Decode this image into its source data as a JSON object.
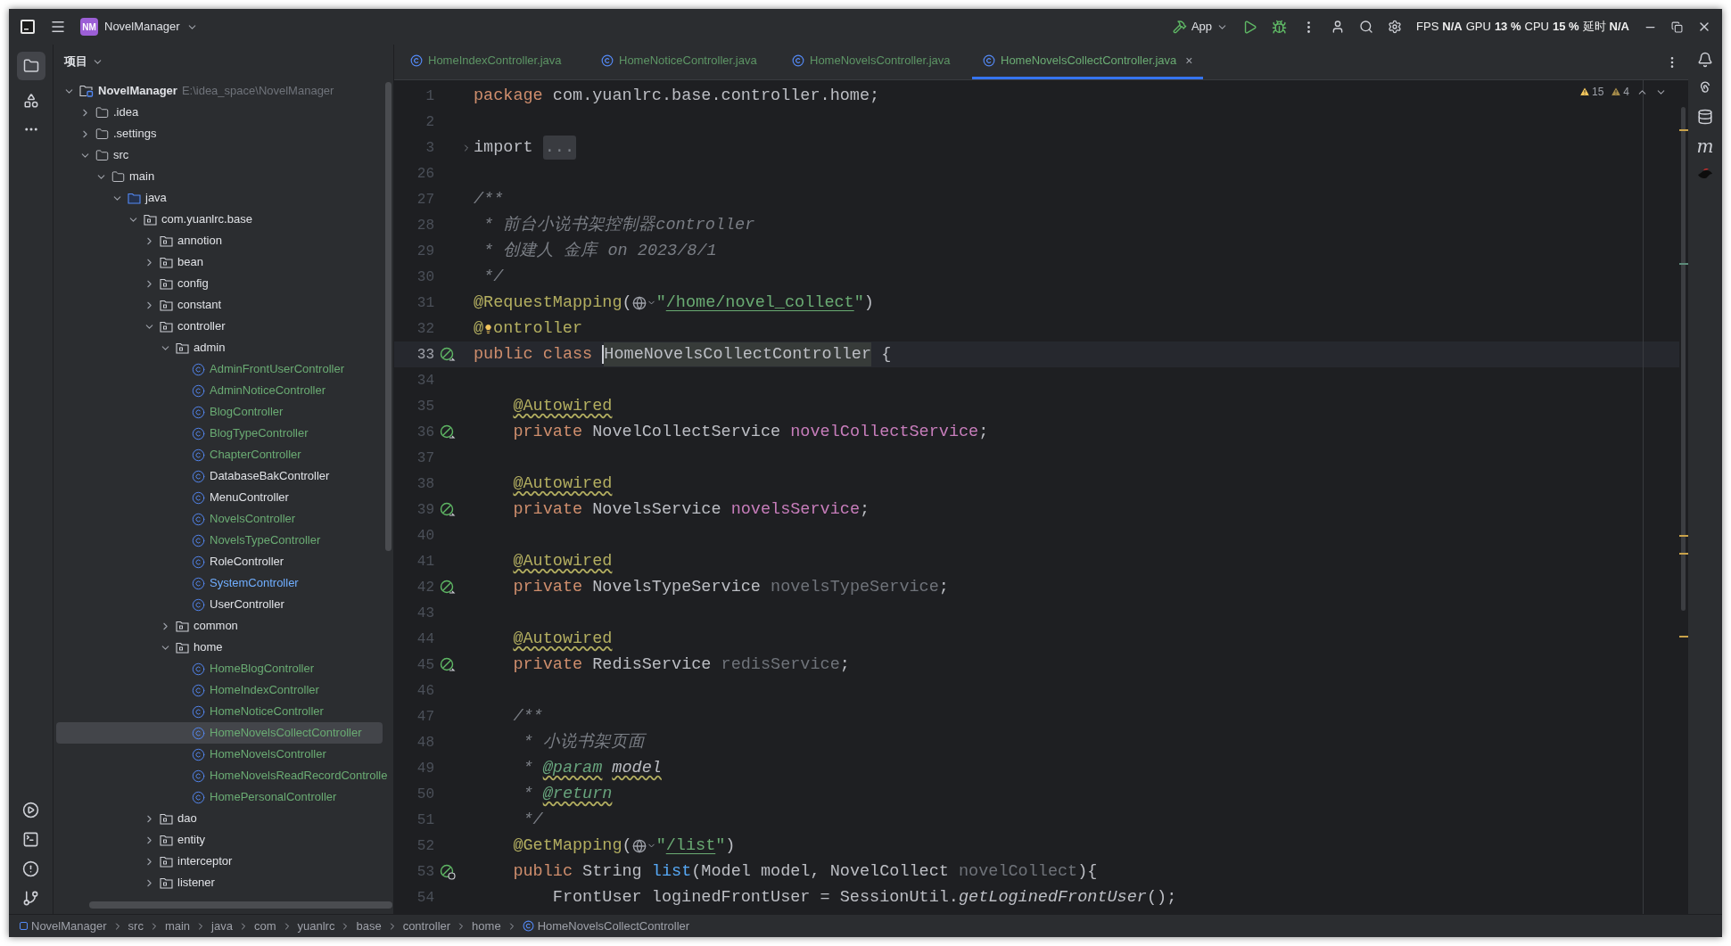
{
  "title_bar": {
    "project_badge": "NM",
    "project_name": "NovelManager",
    "run_config": "App",
    "metrics": [
      {
        "label": "FPS",
        "value": "N/A"
      },
      {
        "label": "GPU",
        "value": "13 %"
      },
      {
        "label": "CPU",
        "value": "15 %"
      },
      {
        "label": "延时",
        "value": "N/A"
      }
    ]
  },
  "project_panel": {
    "title": "项目",
    "tree": [
      {
        "label": "NovelManager",
        "kind": "project",
        "path": "E:\\idea_space\\NovelManager",
        "expanded": true,
        "selected": false,
        "children": [
          {
            "label": ".idea",
            "kind": "folder",
            "expanded": false,
            "selected": false
          },
          {
            "label": ".settings",
            "kind": "folder",
            "expanded": false,
            "selected": false
          },
          {
            "label": "src",
            "kind": "folder",
            "expanded": true,
            "selected": false,
            "children": [
              {
                "label": "main",
                "kind": "folder",
                "expanded": true,
                "selected": false,
                "children": [
                  {
                    "label": "java",
                    "kind": "source-root",
                    "expanded": true,
                    "selected": false,
                    "children": [
                      {
                        "label": "com.yuanlrc.base",
                        "kind": "package",
                        "expanded": true,
                        "selected": false,
                        "children": [
                          {
                            "label": "annotion",
                            "kind": "package",
                            "expanded": false,
                            "selected": false
                          },
                          {
                            "label": "bean",
                            "kind": "package",
                            "expanded": false,
                            "selected": false
                          },
                          {
                            "label": "config",
                            "kind": "package",
                            "expanded": false,
                            "selected": false
                          },
                          {
                            "label": "constant",
                            "kind": "package",
                            "expanded": false,
                            "selected": false
                          },
                          {
                            "label": "controller",
                            "kind": "package",
                            "expanded": true,
                            "selected": false,
                            "children": [
                              {
                                "label": "admin",
                                "kind": "package",
                                "expanded": true,
                                "selected": false,
                                "children": [
                                  {
                                    "label": "AdminFrontUserController",
                                    "kind": "class",
                                    "color": "#6aab73",
                                    "selected": false
                                  },
                                  {
                                    "label": "AdminNoticeController",
                                    "kind": "class",
                                    "color": "#6aab73",
                                    "selected": false
                                  },
                                  {
                                    "label": "BlogController",
                                    "kind": "class",
                                    "color": "#6aab73",
                                    "selected": false
                                  },
                                  {
                                    "label": "BlogTypeController",
                                    "kind": "class",
                                    "color": "#6aab73",
                                    "selected": false
                                  },
                                  {
                                    "label": "ChapterController",
                                    "kind": "class",
                                    "color": "#6aab73",
                                    "selected": false
                                  },
                                  {
                                    "label": "DatabaseBakController",
                                    "kind": "class",
                                    "color": "#dfe1e5",
                                    "selected": false
                                  },
                                  {
                                    "label": "MenuController",
                                    "kind": "class",
                                    "color": "#dfe1e5",
                                    "selected": false
                                  },
                                  {
                                    "label": "NovelsController",
                                    "kind": "class",
                                    "color": "#6aab73",
                                    "selected": false
                                  },
                                  {
                                    "label": "NovelsTypeController",
                                    "kind": "class",
                                    "color": "#6aab73",
                                    "selected": false
                                  },
                                  {
                                    "label": "RoleController",
                                    "kind": "class",
                                    "color": "#dfe1e5",
                                    "selected": false
                                  },
                                  {
                                    "label": "SystemController",
                                    "kind": "class",
                                    "color": "#70aeff",
                                    "selected": false
                                  },
                                  {
                                    "label": "UserController",
                                    "kind": "class",
                                    "color": "#dfe1e5",
                                    "selected": false
                                  }
                                ]
                              },
                              {
                                "label": "common",
                                "kind": "package",
                                "expanded": false,
                                "selected": false
                              },
                              {
                                "label": "home",
                                "kind": "package",
                                "expanded": true,
                                "selected": false,
                                "children": [
                                  {
                                    "label": "HomeBlogController",
                                    "kind": "class",
                                    "color": "#6aab73",
                                    "selected": false
                                  },
                                  {
                                    "label": "HomeIndexController",
                                    "kind": "class",
                                    "color": "#6aab73",
                                    "selected": false
                                  },
                                  {
                                    "label": "HomeNoticeController",
                                    "kind": "class",
                                    "color": "#6aab73",
                                    "selected": false
                                  },
                                  {
                                    "label": "HomeNovelsCollectController",
                                    "kind": "class",
                                    "color": "#6aab73",
                                    "selected": true
                                  },
                                  {
                                    "label": "HomeNovelsController",
                                    "kind": "class",
                                    "color": "#6aab73",
                                    "selected": false
                                  },
                                  {
                                    "label": "HomeNovelsReadRecordControlle",
                                    "kind": "class",
                                    "color": "#6aab73",
                                    "selected": false
                                  },
                                  {
                                    "label": "HomePersonalController",
                                    "kind": "class",
                                    "color": "#6aab73",
                                    "selected": false
                                  }
                                ]
                              }
                            ]
                          },
                          {
                            "label": "dao",
                            "kind": "package",
                            "expanded": false,
                            "selected": false
                          },
                          {
                            "label": "entity",
                            "kind": "package",
                            "expanded": false,
                            "selected": false
                          },
                          {
                            "label": "interceptor",
                            "kind": "package",
                            "expanded": false,
                            "selected": false
                          },
                          {
                            "label": "listener",
                            "kind": "package",
                            "expanded": false,
                            "selected": false
                          }
                        ]
                      }
                    ]
                  }
                ]
              }
            ]
          }
        ]
      }
    ]
  },
  "tabs": [
    {
      "label": "HomeIndexController.java",
      "selected": false
    },
    {
      "label": "HomeNoticeController.java",
      "selected": false
    },
    {
      "label": "HomeNovelsController.java",
      "selected": false
    },
    {
      "label": "HomeNovelsCollectController.java",
      "selected": true,
      "close": "×"
    }
  ],
  "editor": {
    "warnings": "15",
    "weak_warnings": "4",
    "lines": [
      {
        "number": "1",
        "kind": "top",
        "current": false,
        "tokens": [
          {
            "kind": "kw",
            "text": "package"
          },
          {
            "kind": "plain",
            "text": " com.yuanlrc.base.controller.home;"
          }
        ]
      },
      {
        "number": "2",
        "kind": "blank",
        "current": false
      },
      {
        "number": "3",
        "kind": "fold",
        "current": false,
        "tokens": [
          {
            "kind": "plain",
            "text": "import "
          },
          {
            "kind": "folded",
            "text": "..."
          }
        ]
      },
      {
        "number": "26",
        "kind": "blank",
        "current": false
      },
      {
        "number": "27",
        "kind": "top",
        "current": false,
        "tokens": [
          {
            "kind": "comment",
            "text": "/**"
          }
        ]
      },
      {
        "number": "28",
        "kind": "top",
        "current": false,
        "tokens": [
          {
            "kind": "comment",
            "text": " * 前台小说书架控制器controller"
          }
        ]
      },
      {
        "number": "29",
        "kind": "top",
        "current": false,
        "tokens": [
          {
            "kind": "comment",
            "text": " * 创建人 金库 on 2023/8/1"
          }
        ]
      },
      {
        "number": "30",
        "kind": "top",
        "current": false,
        "tokens": [
          {
            "kind": "comment",
            "text": " */"
          }
        ]
      },
      {
        "number": "31",
        "kind": "top",
        "current": false,
        "tokens": [
          {
            "kind": "annot",
            "text": "@RequestMapping"
          },
          {
            "kind": "plain",
            "text": "("
          },
          {
            "kind": "globe"
          },
          {
            "kind": "string",
            "text": "\""
          },
          {
            "kind": "link",
            "text": "/home/novel_collect"
          },
          {
            "kind": "string",
            "text": "\""
          },
          {
            "kind": "plain",
            "text": ")"
          }
        ]
      },
      {
        "number": "32",
        "kind": "top",
        "current": false,
        "tokens": [
          {
            "kind": "annot",
            "text": "@"
          },
          {
            "kind": "bulb"
          },
          {
            "kind": "annot",
            "text": "ontroller"
          }
        ]
      },
      {
        "number": "33",
        "kind": "top",
        "current": true,
        "gutter": {
          "kind": "bean"
        },
        "tokens": [
          {
            "kind": "kw",
            "text": "public class "
          },
          {
            "kind": "caret"
          },
          {
            "kind": "decl",
            "text": "HomeNovelsCollectController"
          },
          {
            "kind": "plain",
            "text": " {"
          }
        ]
      },
      {
        "number": "34",
        "kind": "blank",
        "current": false
      },
      {
        "number": "35",
        "kind": "member",
        "current": false,
        "tokens": [
          {
            "kind": "annot-warn",
            "text": "@Autowired"
          }
        ]
      },
      {
        "number": "36",
        "kind": "member",
        "current": false,
        "gutter": {
          "kind": "bean"
        },
        "tokens": [
          {
            "kind": "kw",
            "text": "private "
          },
          {
            "kind": "plain",
            "text": "NovelCollectService "
          },
          {
            "kind": "field",
            "text": "novelCollectService"
          },
          {
            "kind": "plain",
            "text": ";"
          }
        ]
      },
      {
        "number": "37",
        "kind": "blank",
        "current": false
      },
      {
        "number": "38",
        "kind": "member",
        "current": false,
        "tokens": [
          {
            "kind": "annot-warn",
            "text": "@Autowired"
          }
        ]
      },
      {
        "number": "39",
        "kind": "member",
        "current": false,
        "gutter": {
          "kind": "bean"
        },
        "tokens": [
          {
            "kind": "kw",
            "text": "private "
          },
          {
            "kind": "plain",
            "text": "NovelsService "
          },
          {
            "kind": "field",
            "text": "novelsService"
          },
          {
            "kind": "plain",
            "text": ";"
          }
        ]
      },
      {
        "number": "40",
        "kind": "blank",
        "current": false
      },
      {
        "number": "41",
        "kind": "member",
        "current": false,
        "tokens": [
          {
            "kind": "annot-warn",
            "text": "@Autowired"
          }
        ]
      },
      {
        "number": "42",
        "kind": "member",
        "current": false,
        "gutter": {
          "kind": "bean"
        },
        "tokens": [
          {
            "kind": "kw",
            "text": "private "
          },
          {
            "kind": "plain",
            "text": "NovelsTypeService "
          },
          {
            "kind": "unused",
            "text": "novelsTypeService"
          },
          {
            "kind": "plain",
            "text": ";"
          }
        ]
      },
      {
        "number": "43",
        "kind": "blank",
        "current": false
      },
      {
        "number": "44",
        "kind": "member",
        "current": false,
        "tokens": [
          {
            "kind": "annot-warn",
            "text": "@Autowired"
          }
        ]
      },
      {
        "number": "45",
        "kind": "member",
        "current": false,
        "gutter": {
          "kind": "bean"
        },
        "tokens": [
          {
            "kind": "kw",
            "text": "private "
          },
          {
            "kind": "plain",
            "text": "RedisService "
          },
          {
            "kind": "unused",
            "text": "redisService"
          },
          {
            "kind": "plain",
            "text": ";"
          }
        ]
      },
      {
        "number": "46",
        "kind": "blank",
        "current": false
      },
      {
        "number": "47",
        "kind": "member",
        "current": false,
        "tokens": [
          {
            "kind": "comment",
            "text": "/**"
          }
        ]
      },
      {
        "number": "48",
        "kind": "member",
        "current": false,
        "tokens": [
          {
            "kind": "comment",
            "text": " * 小说书架页面"
          }
        ]
      },
      {
        "number": "49",
        "kind": "member",
        "current": false,
        "tokens": [
          {
            "kind": "comment",
            "text": " * "
          },
          {
            "kind": "doc-tag",
            "text": "@param"
          },
          {
            "kind": "doc-ref",
            "text": "model"
          }
        ]
      },
      {
        "number": "50",
        "kind": "member",
        "current": false,
        "tokens": [
          {
            "kind": "comment",
            "text": " * "
          },
          {
            "kind": "doc-tag",
            "text": "@return"
          }
        ]
      },
      {
        "number": "51",
        "kind": "member",
        "current": false,
        "tokens": [
          {
            "kind": "comment",
            "text": " */"
          }
        ]
      },
      {
        "number": "52",
        "kind": "member",
        "current": false,
        "tokens": [
          {
            "kind": "annot",
            "text": "@GetMapping"
          },
          {
            "kind": "plain",
            "text": "("
          },
          {
            "kind": "globe"
          },
          {
            "kind": "string",
            "text": "\""
          },
          {
            "kind": "link",
            "text": "/list"
          },
          {
            "kind": "string",
            "text": "\""
          },
          {
            "kind": "plain",
            "text": ")"
          }
        ]
      },
      {
        "number": "53",
        "kind": "member",
        "current": false,
        "gutter": {
          "kind": "bean-web"
        },
        "tokens": [
          {
            "kind": "kw",
            "text": "public "
          },
          {
            "kind": "plain",
            "text": "String "
          },
          {
            "kind": "method",
            "text": "list"
          },
          {
            "kind": "plain",
            "text": "(Model model, NovelCollect "
          },
          {
            "kind": "unused",
            "text": "novelCollect"
          },
          {
            "kind": "plain",
            "text": "){"
          }
        ]
      },
      {
        "number": "54",
        "kind": "body",
        "current": false,
        "tokens": [
          {
            "kind": "plain",
            "text": "FrontUser loginedFrontUser = SessionUtil."
          },
          {
            "kind": "static",
            "text": "getLoginedFrontUser"
          },
          {
            "kind": "plain",
            "text": "();"
          }
        ]
      }
    ]
  },
  "right_toolbar": {
    "maven_glyph": "m"
  },
  "breadcrumbs": [
    {
      "label": "NovelManager",
      "kind": "module"
    },
    {
      "label": "src",
      "kind": "dir"
    },
    {
      "label": "main",
      "kind": "dir"
    },
    {
      "label": "java",
      "kind": "dir"
    },
    {
      "label": "com",
      "kind": "dir"
    },
    {
      "label": "yuanlrc",
      "kind": "dir"
    },
    {
      "label": "base",
      "kind": "dir"
    },
    {
      "label": "controller",
      "kind": "dir"
    },
    {
      "label": "home",
      "kind": "dir"
    },
    {
      "label": "HomeNovelsCollectController",
      "kind": "class"
    }
  ]
}
